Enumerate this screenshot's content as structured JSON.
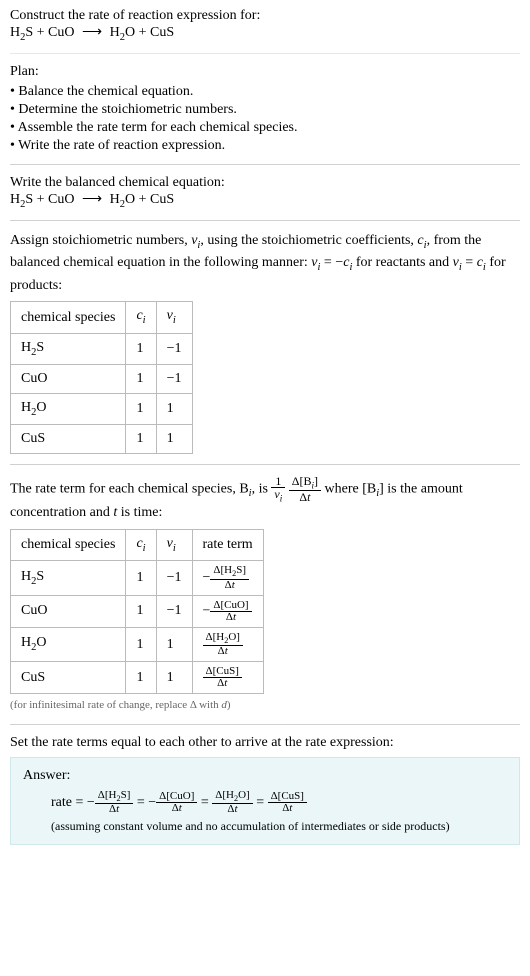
{
  "header": {
    "prompt": "Construct the rate of reaction expression for:",
    "equation_html": "H<sub>2</sub>S + CuO <span class='arrow'>⟶</span> H<sub>2</sub>O + CuS"
  },
  "plan": {
    "title": "Plan:",
    "items": [
      "• Balance the chemical equation.",
      "• Determine the stoichiometric numbers.",
      "• Assemble the rate term for each chemical species.",
      "• Write the rate of reaction expression."
    ]
  },
  "balanced": {
    "title": "Write the balanced chemical equation:",
    "equation_html": "H<sub>2</sub>S + CuO <span class='arrow'>⟶</span> H<sub>2</sub>O + CuS"
  },
  "stoich": {
    "intro_html": "Assign stoichiometric numbers, <span class='ital'>ν<sub>i</sub></span>, using the stoichiometric coefficients, <span class='ital'>c<sub>i</sub></span>, from the balanced chemical equation in the following manner: <span class='ital'>ν<sub>i</sub></span> = −<span class='ital'>c<sub>i</sub></span> for reactants and <span class='ital'>ν<sub>i</sub></span> = <span class='ital'>c<sub>i</sub></span> for products:",
    "headers": {
      "species": "chemical species",
      "ci_html": "<span class='ital'>c<sub>i</sub></span>",
      "nui_html": "<span class='ital'>ν<sub>i</sub></span>"
    },
    "rows": [
      {
        "species_html": "H<sub>2</sub>S",
        "ci": "1",
        "nui": "−1"
      },
      {
        "species_html": "CuO",
        "ci": "1",
        "nui": "−1"
      },
      {
        "species_html": "H<sub>2</sub>O",
        "ci": "1",
        "nui": "1"
      },
      {
        "species_html": "CuS",
        "ci": "1",
        "nui": "1"
      }
    ]
  },
  "rateterm": {
    "intro_html": "The rate term for each chemical species, B<sub><span class='ital'>i</span></sub>, is <span class='frac inline-mid'><span class='num'>1</span><span class='den'><span class='ital'>ν<sub>i</sub></span></span></span> <span class='frac inline-mid'><span class='num'>Δ[B<sub><span class='ital'>i</span></sub>]</span><span class='den'>Δ<span class='ital'>t</span></span></span> where [B<sub><span class='ital'>i</span></sub>] is the amount concentration and <span class='ital'>t</span> is time:",
    "headers": {
      "species": "chemical species",
      "ci_html": "<span class='ital'>c<sub>i</sub></span>",
      "nui_html": "<span class='ital'>ν<sub>i</sub></span>",
      "rate": "rate term"
    },
    "rows": [
      {
        "species_html": "H<sub>2</sub>S",
        "ci": "1",
        "nui": "−1",
        "rate_html": "−<span class='frac frac-sm inline-mid'><span class='num'>Δ[H<sub>2</sub>S]</span><span class='den'>Δ<span class='ital'>t</span></span></span>"
      },
      {
        "species_html": "CuO",
        "ci": "1",
        "nui": "−1",
        "rate_html": "−<span class='frac frac-sm inline-mid'><span class='num'>Δ[CuO]</span><span class='den'>Δ<span class='ital'>t</span></span></span>"
      },
      {
        "species_html": "H<sub>2</sub>O",
        "ci": "1",
        "nui": "1",
        "rate_html": "<span class='frac frac-sm inline-mid'><span class='num'>Δ[H<sub>2</sub>O]</span><span class='den'>Δ<span class='ital'>t</span></span></span>"
      },
      {
        "species_html": "CuS",
        "ci": "1",
        "nui": "1",
        "rate_html": "<span class='frac frac-sm inline-mid'><span class='num'>Δ[CuS]</span><span class='den'>Δ<span class='ital'>t</span></span></span>"
      }
    ],
    "note_html": "(for infinitesimal rate of change, replace Δ with <span class='ital'>d</span>)"
  },
  "final": {
    "intro": "Set the rate terms equal to each other to arrive at the rate expression:",
    "answer_label": "Answer:",
    "answer_html": "rate = −<span class='frac frac-sm inline-mid'><span class='num'>Δ[H<sub>2</sub>S]</span><span class='den'>Δ<span class='ital'>t</span></span></span> = −<span class='frac frac-sm inline-mid'><span class='num'>Δ[CuO]</span><span class='den'>Δ<span class='ital'>t</span></span></span> = <span class='frac frac-sm inline-mid'><span class='num'>Δ[H<sub>2</sub>O]</span><span class='den'>Δ<span class='ital'>t</span></span></span> = <span class='frac frac-sm inline-mid'><span class='num'>Δ[CuS]</span><span class='den'>Δ<span class='ital'>t</span></span></span>",
    "answer_note": "(assuming constant volume and no accumulation of intermediates or side products)"
  }
}
